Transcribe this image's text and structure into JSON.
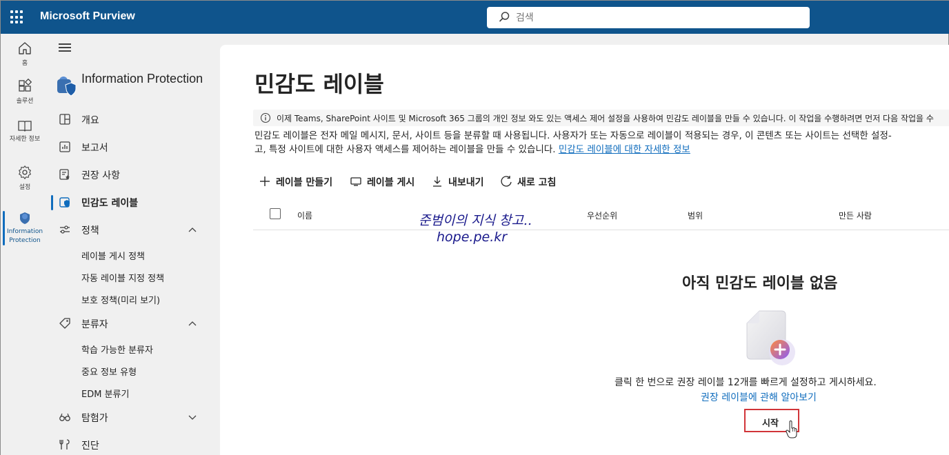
{
  "app": {
    "brand": "Microsoft Purview",
    "search_placeholder": "검색"
  },
  "rail": {
    "items": [
      {
        "label": "홈",
        "icon": "home-icon"
      },
      {
        "label": "솔루션",
        "icon": "solutions-icon"
      },
      {
        "label": "자세한 정보",
        "icon": "learn-icon"
      },
      {
        "label": "설정",
        "icon": "settings-icon"
      },
      {
        "label": "Information Protection",
        "icon": "information-protection-icon",
        "active": true
      }
    ]
  },
  "nav": {
    "app_title": "Information Protection",
    "items": [
      {
        "label": "개요",
        "icon": "overview-icon"
      },
      {
        "label": "보고서",
        "icon": "reports-icon"
      },
      {
        "label": "권장 사항",
        "icon": "recommendations-icon"
      },
      {
        "label": "민감도 레이블",
        "icon": "sensitivity-label-icon",
        "active": true
      },
      {
        "label": "정책",
        "icon": "policy-icon",
        "expanded": true
      },
      {
        "label": "분류자",
        "icon": "classifier-icon",
        "expanded": true
      },
      {
        "label": "탐험가",
        "icon": "explorer-icon",
        "expanded": false
      },
      {
        "label": "진단",
        "icon": "diagnostics-icon"
      }
    ],
    "policy_sub": [
      "레이블 게시 정책",
      "자동 레이블 지정 정책",
      "보호 정책(미리 보기)"
    ],
    "classifier_sub": [
      "학습 가능한 분류자",
      "중요 정보 유형",
      "EDM 분류기"
    ]
  },
  "main": {
    "title": "민감도 레이블",
    "info_bar": "이제 Teams, SharePoint 사이트 및 Microsoft 365 그룹의 개인 정보 와도 있는 액세스 제어 설정을 사용하여 민감도 레이블을 만들 수 있습니다. 이 작업을 수행하려면 먼저 다음 작업을 수",
    "desc_line1": "민감도 레이블은 전자 메일 메시지, 문서, 사이트 등을 분류할 때 사용됩니다. 사용자가 또는 자동으로 레이블이 적용되는 경우, 이 콘텐츠 또는 사이트는 선택한 설정-",
    "desc_line2": "고, 특정 사이트에 대한 사용자 액세스를 제어하는 레이블을 만들 수 있습니다.",
    "desc_link": "민감도 레이블에 대한 자세한 정보",
    "toolbar": {
      "create": "레이블 만들기",
      "publish": "레이블 게시",
      "export": "내보내기",
      "refresh": "새로 고침"
    },
    "columns": {
      "name": "이름",
      "priority": "우선순위",
      "scope": "범위",
      "created_by": "만든 사람"
    },
    "watermark_line1": "준범이의 지식 창고..",
    "watermark_line2": "hope.pe.kr",
    "empty": {
      "title": "아직 민감도 레이블 없음",
      "message": "클릭 한 번으로 권장 레이블 12개를 빠르게 설정하고 게시하세요.",
      "link": "권장 레이블에 관해 알아보기",
      "button": "시작"
    }
  },
  "colors": {
    "topbar": "#0f548c",
    "accent": "#0f6cbd",
    "highlight_border": "#d13438"
  }
}
